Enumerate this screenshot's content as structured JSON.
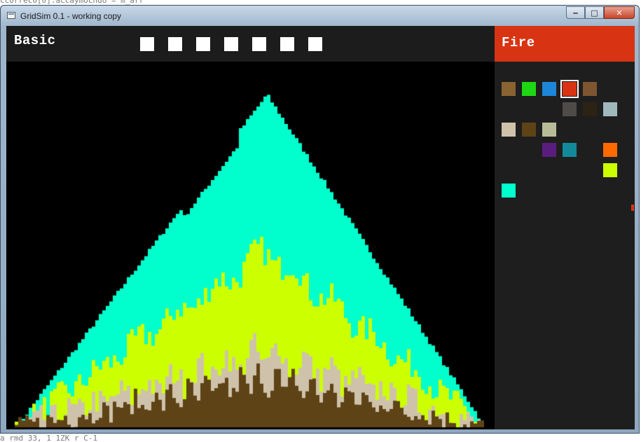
{
  "background": {
    "code_top": "ccorrec0[0].accaymocndo = m_arr",
    "code_bottom": "a  rmd  33,  1 1ZK  r_C-1  _"
  },
  "window": {
    "title": "GridSim 0.1 - working copy",
    "controls": {
      "minimize": "‒",
      "maximize": "□",
      "close": "✕"
    }
  },
  "toolbar": {
    "mode_label": "Basic",
    "slot_count": 7
  },
  "selected_material": {
    "label": "Fire",
    "color": "#d83413"
  },
  "palette": [
    {
      "name": "palette-swatch-1",
      "color": "#8a6332",
      "row": 0,
      "col": 0
    },
    {
      "name": "palette-swatch-2",
      "color": "#1ed613",
      "row": 0,
      "col": 1
    },
    {
      "name": "palette-swatch-3",
      "color": "#1e86d8",
      "row": 0,
      "col": 2
    },
    {
      "name": "palette-swatch-4",
      "color": "#d83413",
      "row": 0,
      "col": 3,
      "selected": true
    },
    {
      "name": "palette-swatch-5",
      "color": "#7d5530",
      "row": 0,
      "col": 4
    },
    {
      "name": "palette-swatch-6",
      "color": "#4f4b48",
      "row": 1,
      "col": 3
    },
    {
      "name": "palette-swatch-7",
      "color": "#2c2314",
      "row": 1,
      "col": 4
    },
    {
      "name": "palette-swatch-8",
      "color": "#9fb8bc",
      "row": 1,
      "col": 5
    },
    {
      "name": "palette-swatch-9",
      "color": "#cfc2ab",
      "row": 2,
      "col": 0
    },
    {
      "name": "palette-swatch-10",
      "color": "#5e4316",
      "row": 2,
      "col": 1
    },
    {
      "name": "palette-swatch-11",
      "color": "#b8bc96",
      "row": 2,
      "col": 2
    },
    {
      "name": "palette-swatch-12",
      "color": "#5a1d7d",
      "row": 3,
      "col": 2
    },
    {
      "name": "palette-swatch-13",
      "color": "#128a99",
      "row": 3,
      "col": 3
    },
    {
      "name": "palette-swatch-14",
      "color": "#ff6a00",
      "row": 3,
      "col": 5
    },
    {
      "name": "palette-swatch-15",
      "color": "#ccff00",
      "row": 4,
      "col": 5
    },
    {
      "name": "palette-swatch-16",
      "color": "#00ffcc",
      "row": 5,
      "col": 0
    }
  ],
  "simulation": {
    "layers": [
      {
        "name": "cyan-layer",
        "color": "#00ffcc"
      },
      {
        "name": "yellow-layer",
        "color": "#ccff00"
      },
      {
        "name": "sand-layer",
        "color": "#cfc2ab"
      },
      {
        "name": "dirt-layer",
        "color": "#5e4316"
      }
    ]
  }
}
